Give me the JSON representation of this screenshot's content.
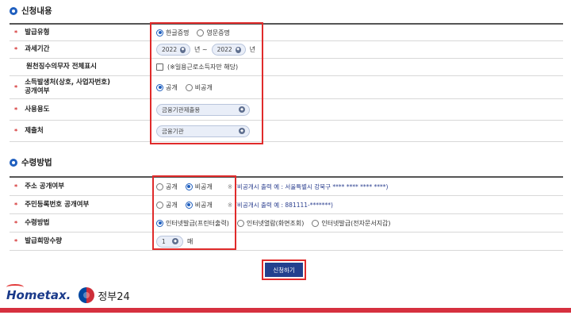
{
  "colors": {
    "accent": "#1f5fbf",
    "highlight": "#e02b2b",
    "button": "#23408e",
    "footer_bar": "#d6303f"
  },
  "section1": {
    "title": "신청내용",
    "rows": {
      "issue_type": {
        "label": "발급유형",
        "options": [
          "한글증명",
          "영문증명"
        ],
        "selected": "한글증명"
      },
      "tax_period": {
        "label": "과세기간",
        "from": "2022",
        "from_suffix": "년 ~",
        "to": "2022",
        "to_suffix": "년"
      },
      "withholding": {
        "label": "원천징수의무자 전체표시",
        "checkbox_text": "(※일용근로소득자만 해당)",
        "checked": false
      },
      "disclosure": {
        "label_line1": "소득발생처(상호, 사업자번호)",
        "label_line2": "공개여부",
        "options": [
          "공개",
          "비공개"
        ],
        "selected": "공개"
      },
      "usage": {
        "label": "사용용도",
        "value": "금융기관제출용"
      },
      "submit_to": {
        "label": "제출처",
        "value": "금융기관"
      }
    }
  },
  "section2": {
    "title": "수령방법",
    "rows": {
      "address": {
        "label": "주소 공개여부",
        "options": [
          "공개",
          "비공개"
        ],
        "selected": "비공개",
        "note_mark": "※",
        "note": "(비공개시 출력 예 : 서울특별시 강북구 **** **** **** ****)"
      },
      "rrn": {
        "label": "주민등록번호 공개여부",
        "options": [
          "공개",
          "비공개"
        ],
        "selected": "비공개",
        "note_mark": "※",
        "note": "(비공개시 출력 예 : 881111-*******)"
      },
      "receive": {
        "label": "수령방법",
        "options": [
          "인터넷발급(프린터출력)",
          "인터넷열람(화면조회)",
          "인터넷발급(전자문서지갑)"
        ],
        "selected": "인터넷발급(프린터출력)"
      },
      "count": {
        "label": "발급희망수량",
        "value": "1",
        "unit": "매"
      }
    }
  },
  "submit_label": "신청하기",
  "footer": {
    "hometax": "Hometax.",
    "gov24": "정부24"
  },
  "icons": [
    "section-bullet-icon",
    "select-arrow-icon",
    "government-emblem-icon"
  ]
}
